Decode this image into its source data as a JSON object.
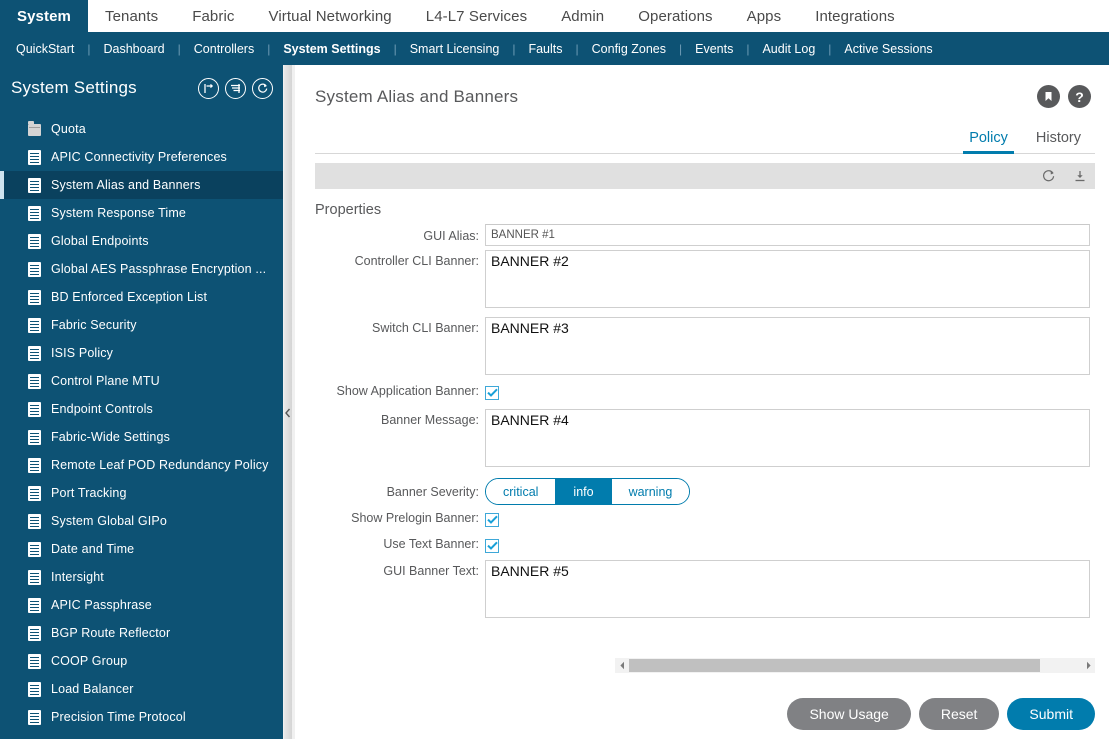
{
  "topnav": {
    "items": [
      {
        "label": "System",
        "active": true
      },
      {
        "label": "Tenants",
        "active": false
      },
      {
        "label": "Fabric",
        "active": false
      },
      {
        "label": "Virtual Networking",
        "active": false
      },
      {
        "label": "L4-L7 Services",
        "active": false
      },
      {
        "label": "Admin",
        "active": false
      },
      {
        "label": "Operations",
        "active": false
      },
      {
        "label": "Apps",
        "active": false
      },
      {
        "label": "Integrations",
        "active": false
      }
    ]
  },
  "subnav": {
    "items": [
      {
        "label": "QuickStart",
        "active": false
      },
      {
        "label": "Dashboard",
        "active": false
      },
      {
        "label": "Controllers",
        "active": false
      },
      {
        "label": "System Settings",
        "active": true
      },
      {
        "label": "Smart Licensing",
        "active": false
      },
      {
        "label": "Faults",
        "active": false
      },
      {
        "label": "Config Zones",
        "active": false
      },
      {
        "label": "Events",
        "active": false
      },
      {
        "label": "Audit Log",
        "active": false
      },
      {
        "label": "Active Sessions",
        "active": false
      }
    ]
  },
  "sidebar": {
    "title": "System Settings",
    "icons": [
      "collapse-icon",
      "filter-list-icon",
      "refresh-icon"
    ],
    "items": [
      {
        "label": "Quota",
        "icon": "folder-icon",
        "selected": false
      },
      {
        "label": "APIC Connectivity Preferences",
        "icon": "document-icon",
        "selected": false
      },
      {
        "label": "System Alias and Banners",
        "icon": "document-icon",
        "selected": true
      },
      {
        "label": "System Response Time",
        "icon": "document-icon",
        "selected": false
      },
      {
        "label": "Global Endpoints",
        "icon": "document-icon",
        "selected": false
      },
      {
        "label": "Global AES Passphrase Encryption ...",
        "icon": "document-icon",
        "selected": false
      },
      {
        "label": "BD Enforced Exception List",
        "icon": "document-icon",
        "selected": false
      },
      {
        "label": "Fabric Security",
        "icon": "document-icon",
        "selected": false
      },
      {
        "label": "ISIS Policy",
        "icon": "document-icon",
        "selected": false
      },
      {
        "label": "Control Plane MTU",
        "icon": "document-icon",
        "selected": false
      },
      {
        "label": "Endpoint Controls",
        "icon": "document-icon",
        "selected": false
      },
      {
        "label": "Fabric-Wide Settings",
        "icon": "document-icon",
        "selected": false
      },
      {
        "label": "Remote Leaf POD Redundancy Policy",
        "icon": "document-icon",
        "selected": false
      },
      {
        "label": "Port Tracking",
        "icon": "document-icon",
        "selected": false
      },
      {
        "label": "System Global GIPo",
        "icon": "document-icon",
        "selected": false
      },
      {
        "label": "Date and Time",
        "icon": "document-icon",
        "selected": false
      },
      {
        "label": "Intersight",
        "icon": "document-icon",
        "selected": false
      },
      {
        "label": "APIC Passphrase",
        "icon": "document-icon",
        "selected": false
      },
      {
        "label": "BGP Route Reflector",
        "icon": "document-icon",
        "selected": false
      },
      {
        "label": "COOP Group",
        "icon": "document-icon",
        "selected": false
      },
      {
        "label": "Load Balancer",
        "icon": "document-icon",
        "selected": false
      },
      {
        "label": "Precision Time Protocol",
        "icon": "document-icon",
        "selected": false
      }
    ]
  },
  "main": {
    "title": "System Alias and Banners",
    "header_icons": [
      "bookmark-icon",
      "help-icon"
    ],
    "tabs": [
      {
        "label": "Policy",
        "active": true
      },
      {
        "label": "History",
        "active": false
      }
    ],
    "toolbar_icons": [
      "refresh-icon",
      "download-icon"
    ],
    "properties_title": "Properties",
    "fields": {
      "gui_alias": {
        "label": "GUI Alias:",
        "value": "BANNER #1"
      },
      "controller_cli_banner": {
        "label": "Controller CLI Banner:",
        "value": "BANNER #2"
      },
      "switch_cli_banner": {
        "label": "Switch CLI Banner:",
        "value": "BANNER #3"
      },
      "show_application_banner": {
        "label": "Show Application Banner:",
        "checked": true
      },
      "banner_message": {
        "label": "Banner Message:",
        "value": "BANNER #4"
      },
      "banner_severity": {
        "label": "Banner Severity:",
        "options": [
          "critical",
          "info",
          "warning"
        ],
        "selected": "info"
      },
      "show_prelogin_banner": {
        "label": "Show Prelogin Banner:",
        "checked": true
      },
      "use_text_banner": {
        "label": "Use Text Banner:",
        "checked": true
      },
      "gui_banner_text": {
        "label": "GUI Banner Text:",
        "value": "BANNER #5"
      }
    },
    "buttons": [
      {
        "label": "Show Usage",
        "style": "secondary"
      },
      {
        "label": "Reset",
        "style": "secondary"
      },
      {
        "label": "Submit",
        "style": "primary"
      }
    ]
  },
  "colors": {
    "brand_dark_blue": "#0d5274",
    "accent_blue": "#017cad",
    "selected_nav": "#0a415e",
    "gray_button": "#808184",
    "text_gray": "#58595b"
  }
}
